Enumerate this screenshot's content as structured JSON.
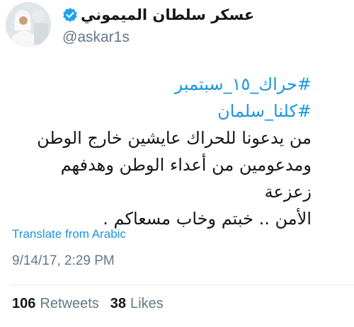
{
  "author": {
    "display_name": "عسكر سلطان الميموني",
    "handle": "@askar1s",
    "verified": true
  },
  "tweet": {
    "hashtags": [
      "#حراك_١٥_سبتمبر",
      "#كلنا_سلمان"
    ],
    "lines": [
      "من يدعونا للحراك عايشين خارج الوطن",
      "ومدعومين من أعداء الوطن وهدفهم زعزعة",
      "الأمن .. خبتم وخاب مسعاكم ."
    ]
  },
  "translate_label": "Translate from Arabic",
  "timestamp": "9/14/17, 2:29 PM",
  "stats": {
    "retweets_count": "106",
    "retweets_label": "Retweets",
    "likes_count": "38",
    "likes_label": "Likes"
  },
  "colors": {
    "link": "#1b95e0",
    "secondary_text": "#657786",
    "verified_badge": "#1da1f2"
  }
}
